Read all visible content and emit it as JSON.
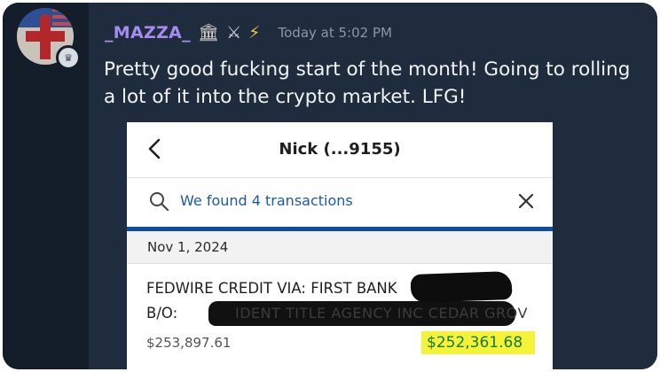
{
  "post": {
    "username": "_MAZZA_",
    "role_icons": [
      "bank-icon",
      "crossed-swords-icon",
      "lightning-icon"
    ],
    "timestamp": "Today at 5:02 PM",
    "message": "Pretty good fucking start of the month! Going to rolling a lot of it into the crypto market. LFG!"
  },
  "screenshot": {
    "title": "Nick  (...9155)",
    "search_text": "We found 4 transactions",
    "date": "Nov 1, 2024",
    "transaction": {
      "line1": "FEDWIRE CREDIT VIA: FIRST BANK",
      "line2": "B/O:",
      "redacted_ghost": "IDENT TITLE AGENCY INC CEDAR GROV",
      "balance": "$253,897.61",
      "amount": "$252,361.68"
    }
  },
  "colors": {
    "background": "#1e2a3b",
    "username": "#a58cf0",
    "link_blue": "#1c5aa8",
    "highlight": "#f5f23a",
    "amount_green": "#1a7a2a"
  }
}
